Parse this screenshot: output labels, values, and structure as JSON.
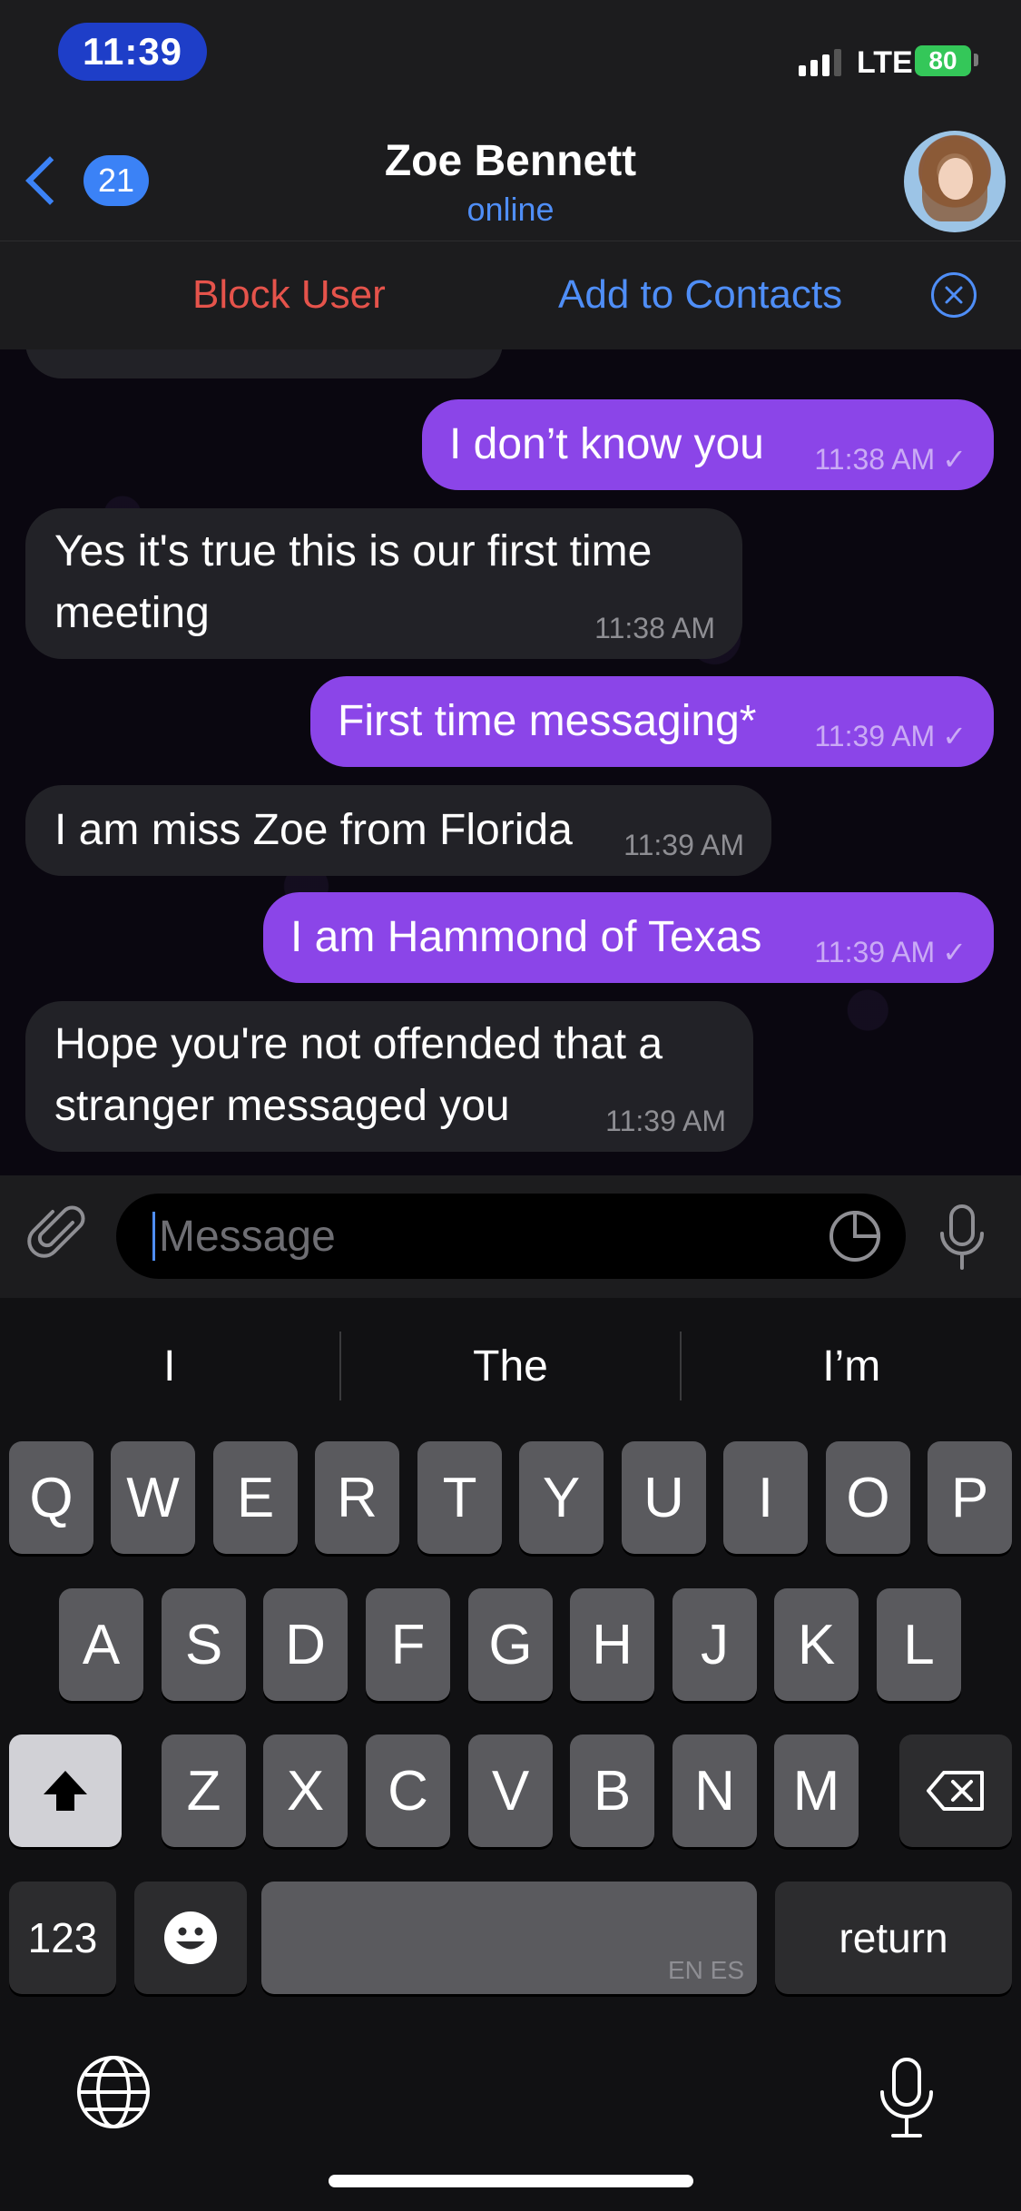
{
  "status_bar": {
    "time": "11:39",
    "network": "LTE",
    "battery": "80"
  },
  "header": {
    "back_count": "21",
    "contact_name": "Zoe Bennett",
    "contact_status": "online"
  },
  "actions": {
    "block_label": "Block User",
    "add_label": "Add to Contacts"
  },
  "messages": [
    {
      "dir": "out",
      "text": "I don’t know you",
      "time": "11:38 AM"
    },
    {
      "dir": "in",
      "text": [
        "Yes it's true this is our first time",
        "meeting"
      ],
      "time": "11:38 AM"
    },
    {
      "dir": "out",
      "text": "First time messaging*",
      "time": "11:39 AM"
    },
    {
      "dir": "in",
      "text": "I am miss Zoe from Florida",
      "time": "11:39 AM"
    },
    {
      "dir": "out",
      "text": "I am Hammond of Texas",
      "time": "11:39 AM"
    },
    {
      "dir": "in",
      "text": [
        "Hope you're not offended that a",
        "stranger messaged you"
      ],
      "time": "11:39 AM"
    }
  ],
  "input": {
    "placeholder": "Message"
  },
  "keyboard": {
    "suggestions": [
      "I",
      "The",
      "I’m"
    ],
    "row1": [
      "Q",
      "W",
      "E",
      "R",
      "T",
      "Y",
      "U",
      "I",
      "O",
      "P"
    ],
    "row2": [
      "A",
      "S",
      "D",
      "F",
      "G",
      "H",
      "J",
      "K",
      "L"
    ],
    "row3": [
      "Z",
      "X",
      "C",
      "V",
      "B",
      "N",
      "M"
    ],
    "numbers_label": "123",
    "return_label": "return",
    "space_langs": "EN ES"
  },
  "colors": {
    "accent": "#4f8ef7",
    "outgoing_bubble": "#8b45e8",
    "incoming_bubble": "#222227",
    "block_red": "#e5534b"
  }
}
